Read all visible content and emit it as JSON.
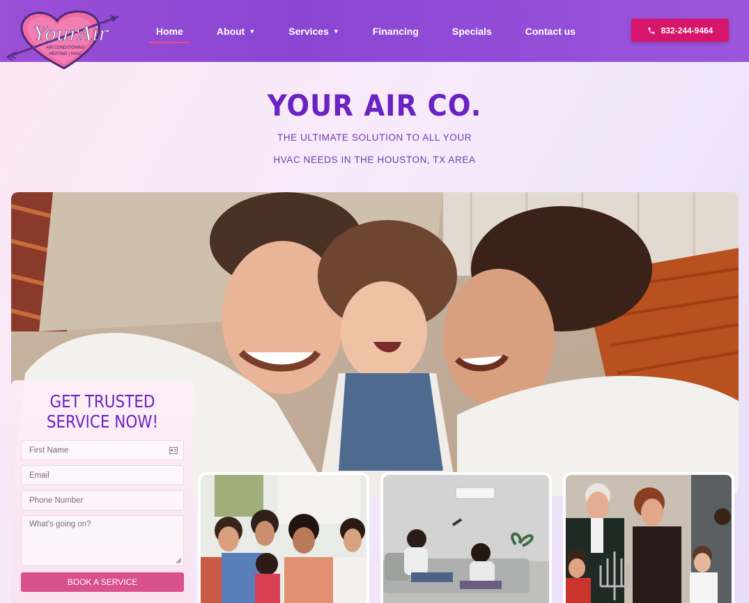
{
  "brand": {
    "logo_main": "YourAir",
    "logo_line1": "AIR CONDITIONING",
    "logo_line2": "HEATING | HVAC"
  },
  "nav": {
    "items": [
      {
        "label": "Home",
        "active": true,
        "dropdown": false
      },
      {
        "label": "About",
        "active": false,
        "dropdown": true
      },
      {
        "label": "Services",
        "active": false,
        "dropdown": true
      },
      {
        "label": "Financing",
        "active": false,
        "dropdown": false
      },
      {
        "label": "Specials",
        "active": false,
        "dropdown": false
      },
      {
        "label": "Contact us",
        "active": false,
        "dropdown": false
      }
    ],
    "phone": "832-244-9464"
  },
  "hero": {
    "title": "YOUR AIR CO.",
    "subtitle_line1": "THE ULTIMATE SOLUTION TO ALL YOUR",
    "subtitle_line2": "HVAC NEEDS IN THE HOUSTON, TX AREA"
  },
  "form": {
    "title_line1": "GET TRUSTED",
    "title_line2": "SERVICE NOW!",
    "first_name_placeholder": "First Name",
    "email_placeholder": "Email",
    "phone_placeholder": "Phone Number",
    "message_placeholder": "What's going on?",
    "submit_label": "BOOK A SERVICE"
  },
  "colors": {
    "header": "#8a45d3",
    "accent": "#d6156b",
    "title": "#6a22c2",
    "button": "#d9508f"
  }
}
